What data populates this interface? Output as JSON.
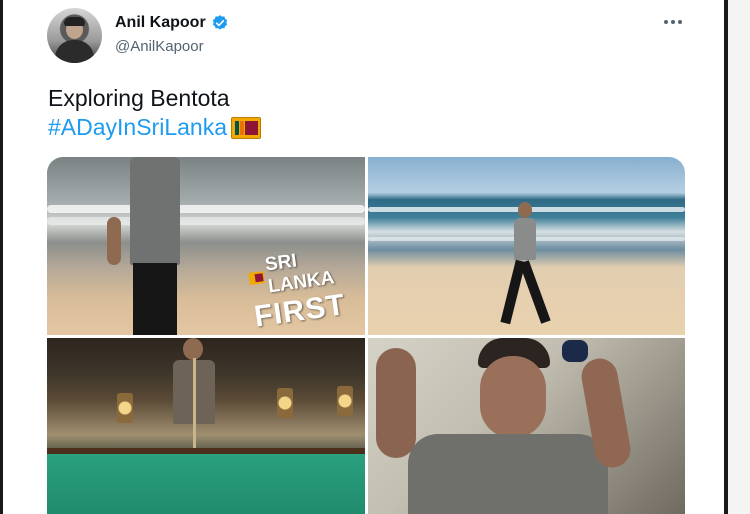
{
  "author": {
    "display_name": "Anil Kapoor",
    "handle": "@AnilKapoor",
    "verified": true
  },
  "tweet": {
    "text_line1": "Exploring Bentota",
    "hashtag": "#ADayInSriLanka",
    "emoji": "flag-sri-lanka-icon"
  },
  "media": {
    "overlay_line1": "SRI LANKA",
    "overlay_line2": "FIRST"
  },
  "colors": {
    "link": "#1d9bf0",
    "verified_badge": "#1d9bf0",
    "secondary_text": "#536471",
    "primary_text": "#0f1419"
  }
}
